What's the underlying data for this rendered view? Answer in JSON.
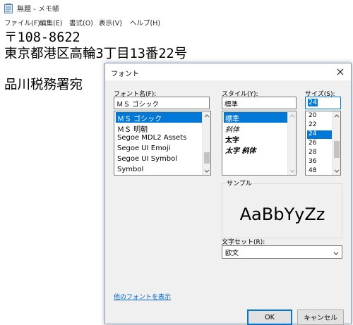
{
  "window": {
    "title": "無題 - メモ帳"
  },
  "menu": [
    {
      "label": "ファイル(F)"
    },
    {
      "label": "編集(E)"
    },
    {
      "label": "書式(O)"
    },
    {
      "label": "表示(V)"
    },
    {
      "label": "ヘルプ(H)"
    }
  ],
  "document": {
    "lines": [
      "〒108-8622",
      "東京都港区高輪3丁目13番22号",
      "",
      "品川税務署宛"
    ]
  },
  "font_dialog": {
    "title": "フォント",
    "font_name": {
      "label": "フォント名(F):",
      "value": "ＭＳ ゴシック",
      "items": [
        "ＭＳ ゴシック",
        "ＭＳ 明朝",
        "Segoe MDL2 Assets",
        "Segoe UI Emoji",
        "Segoe UI Symbol",
        "Symbol"
      ],
      "selected_index": 0
    },
    "style": {
      "label": "スタイル(Y):",
      "value": "標準",
      "items": [
        "標準",
        "斜体",
        "太字",
        "太字 斜体"
      ],
      "selected_index": 0
    },
    "size": {
      "label": "サイズ(S):",
      "value": "24",
      "items": [
        "20",
        "22",
        "24",
        "26",
        "28",
        "36",
        "48"
      ],
      "selected_index": 2
    },
    "sample": {
      "label": "サンプル",
      "text": "AaBbYyZz"
    },
    "charset": {
      "label": "文字セット(R):",
      "value": "欧文"
    },
    "more_fonts_link": "他のフォントを表示",
    "ok_label": "OK",
    "cancel_label": "キャンセル"
  },
  "colors": {
    "accent": "#0078d7",
    "link": "#0066cc"
  }
}
